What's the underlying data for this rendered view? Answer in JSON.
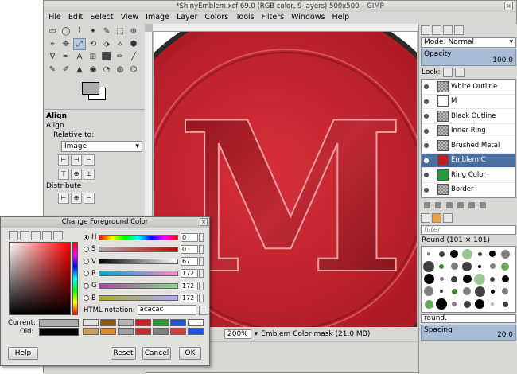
{
  "window": {
    "title": "*ShinyEmblem.xcf-69.0 (RGB color, 9 layers) 500x500 – GIMP",
    "close_glyph": "×"
  },
  "menu": [
    "File",
    "Edit",
    "Select",
    "View",
    "Image",
    "Layer",
    "Colors",
    "Tools",
    "Filters",
    "Windows",
    "Help"
  ],
  "toolbox": {
    "tools": [
      "▭",
      "◯",
      "⌇",
      "✦",
      "✎",
      "⬚",
      "⊕",
      "⌖",
      "✥",
      "⤢",
      "⟲",
      "⬗",
      "⟡",
      "⬢",
      "ᐁ",
      "✒",
      "A",
      "⊞",
      "⬛",
      "✏",
      "╱",
      "✎",
      "✐",
      "▲",
      "◉",
      "◔",
      "◍",
      "⌬"
    ],
    "align": {
      "title": "Align",
      "subtitle": "Align",
      "relative_label": "Relative to:",
      "relative_value": "Image",
      "distribute_label": "Distribute"
    },
    "fg_color": "#acacac",
    "bg_color": "#ffffff"
  },
  "canvas": {
    "letter": "M",
    "zoom": "200%",
    "unit": "px",
    "status": "Emblem Color mask (21.0 MB)"
  },
  "rpanel": {
    "mode_label": "Mode:",
    "mode_value": "Normal",
    "opacity_label": "Opacity",
    "opacity_value": "100.0",
    "lock_label": "Lock:",
    "layers": [
      {
        "name": "White Outline",
        "selected": false
      },
      {
        "name": "M",
        "selected": false
      },
      {
        "name": "Black Outline",
        "selected": false
      },
      {
        "name": "Inner Ring",
        "selected": false
      },
      {
        "name": "Brushed Metal",
        "selected": false
      },
      {
        "name": "Emblem C",
        "selected": true
      },
      {
        "name": "Ring Color",
        "selected": false
      },
      {
        "name": "Border",
        "selected": false
      }
    ],
    "brush_filter": "filter",
    "brush_title": "Round (101 × 101)",
    "brush_name": "round.",
    "spacing_label": "Spacing",
    "spacing_value": "20.0"
  },
  "dialog": {
    "title": "Change Foreground Color",
    "channels": [
      {
        "label": "H",
        "value": "0",
        "grad": "linear-gradient(to right,#f00,#ff0,#0f0,#0ff,#00f,#f0f,#f00)"
      },
      {
        "label": "S",
        "value": "0",
        "grad": "linear-gradient(to right,#acacac,#c00)"
      },
      {
        "label": "V",
        "value": "67",
        "grad": "linear-gradient(to right,#000,#fff)"
      },
      {
        "label": "R",
        "value": "172",
        "grad": "linear-gradient(to right,#0ac,#f8c)"
      },
      {
        "label": "G",
        "value": "172",
        "grad": "linear-gradient(to right,#a4a,#8d8)"
      },
      {
        "label": "B",
        "value": "172",
        "grad": "linear-gradient(to right,#aa2,#aaf)"
      }
    ],
    "html_label": "HTML notation:",
    "html_value": "acacac",
    "current_label": "Current:",
    "old_label": "Old:",
    "history": [
      "#8a5a1e",
      "#b5b5b5",
      "#cc2222",
      "#2b9b3a",
      "#2255cc",
      "#ffffff",
      "#c8a060",
      "#e08a30",
      "#a0a0a0",
      "#c03030",
      "#808080",
      "#d04040",
      "#2255dd"
    ],
    "help": "Help",
    "reset": "Reset",
    "cancel": "Cancel",
    "ok": "OK"
  }
}
